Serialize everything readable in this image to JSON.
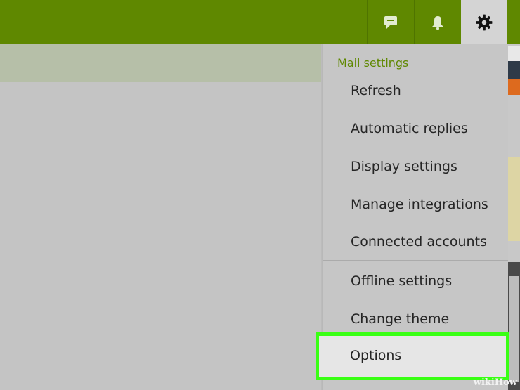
{
  "header": {
    "chat_icon": "chat-bubble-icon",
    "notification_icon": "bell-icon",
    "settings_icon": "gear-icon"
  },
  "settings_menu": {
    "section_title": "Mail settings",
    "items": [
      {
        "label": "Refresh"
      },
      {
        "label": "Automatic replies"
      },
      {
        "label": "Display settings"
      },
      {
        "label": "Manage integrations"
      },
      {
        "label": "Connected accounts"
      },
      {
        "label": "Offline settings"
      },
      {
        "label": "Change theme"
      },
      {
        "label": "Options"
      }
    ]
  },
  "colors": {
    "header_green": "#5f8800",
    "highlight_green": "#39ff14"
  },
  "watermark": "wikiHow"
}
